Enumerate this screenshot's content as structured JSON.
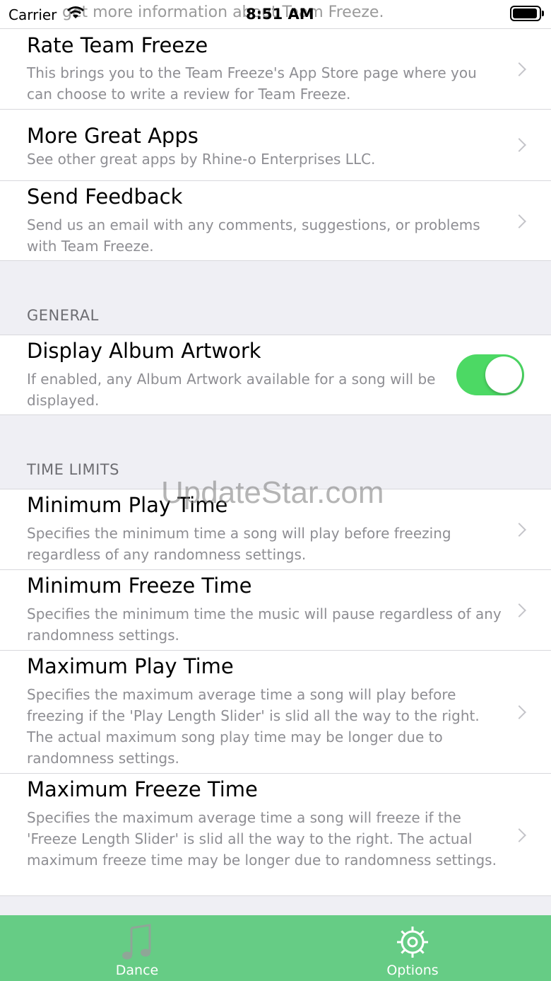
{
  "status_bar": {
    "carrier": "Carrier",
    "time": "8:51 AM",
    "partial_text": "get more information about Team Freeze."
  },
  "about": {
    "rate": {
      "title": "Rate Team Freeze",
      "desc": "This brings you to the Team Freeze's App Store page where you can choose to write a review for Team Freeze."
    },
    "more": {
      "title": "More Great Apps",
      "desc": "See other great apps by Rhine-o Enterprises LLC."
    },
    "feedback": {
      "title": "Send Feedback",
      "desc": "Send us an email with any comments, suggestions, or problems with Team Freeze."
    }
  },
  "general": {
    "header": "GENERAL",
    "artwork": {
      "title": "Display Album Artwork",
      "desc": "If enabled, any Album Artwork available for a song will be displayed.",
      "enabled": true
    }
  },
  "time_limits": {
    "header": "TIME LIMITS",
    "min_play": {
      "title": "Minimum Play Time",
      "desc": "Specifies the minimum time a song will play before freezing regardless of any randomness settings."
    },
    "min_freeze": {
      "title": "Minimum Freeze Time",
      "desc": "Specifies the minimum time the music will pause regardless of any randomness settings."
    },
    "max_play": {
      "title": "Maximum Play Time",
      "desc": "Specifies the maximum average time a song will play before freezing if the 'Play Length Slider' is slid all the way to the right.  The actual maximum song play time may be longer due to randomness settings."
    },
    "max_freeze": {
      "title": "Maximum Freeze Time",
      "desc": "Specifies the maximum average time a song will freeze if the 'Freeze Length Slider' is slid all the way to the right.  The actual maximum freeze time may be longer due to randomness settings."
    }
  },
  "watermark": "UpdateStar.com",
  "tab_bar": {
    "dance": {
      "label": "Dance",
      "icon": "music-note-icon"
    },
    "options": {
      "label": "Options",
      "icon": "gear-icon"
    }
  },
  "colors": {
    "accent": "#66cc85",
    "toggle_on": "#4cd964",
    "secondary_text": "#8e8e93",
    "background": "#efeff4"
  }
}
